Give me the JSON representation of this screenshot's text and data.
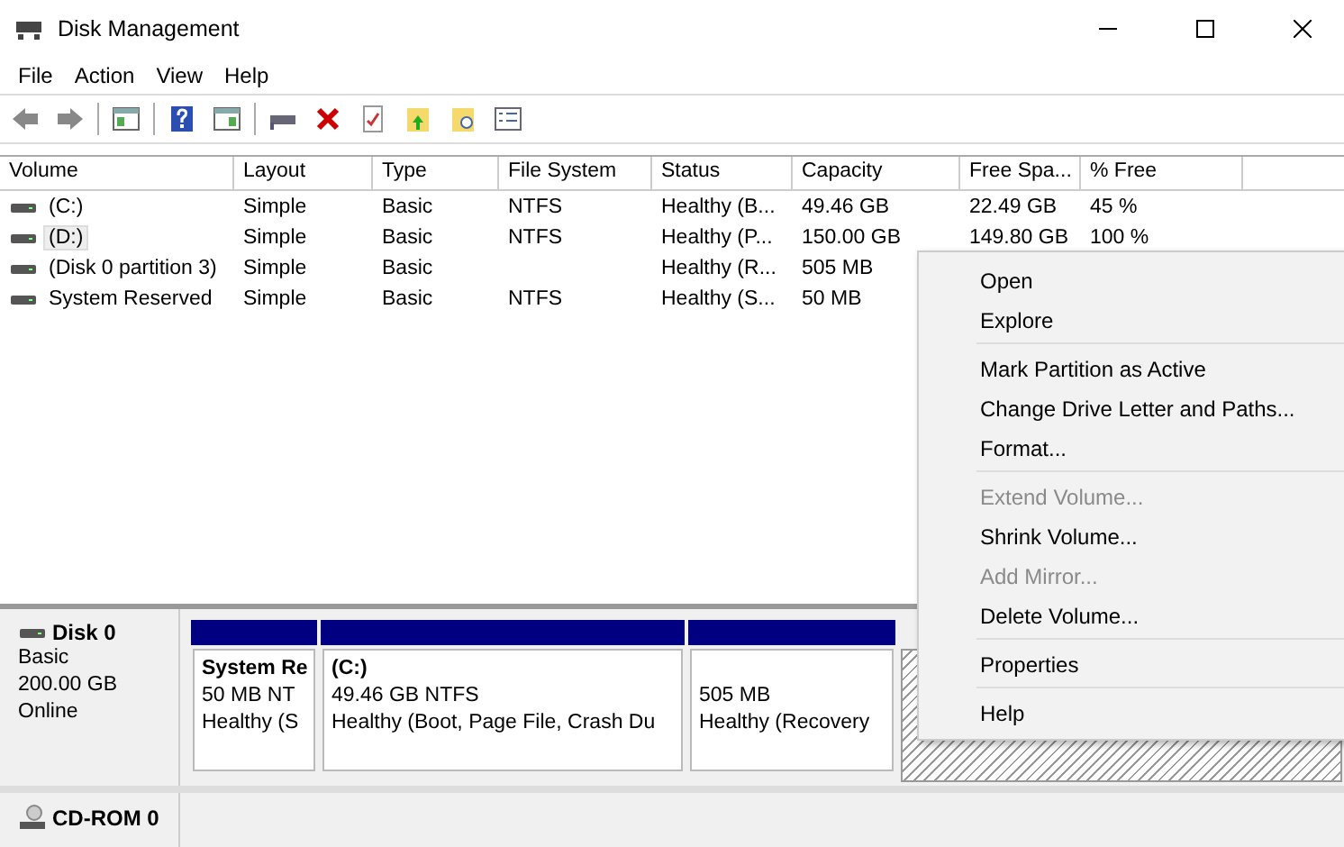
{
  "window": {
    "title": "Disk Management"
  },
  "menu_bar": [
    "File",
    "Action",
    "View",
    "Help"
  ],
  "table": {
    "columns": [
      "Volume",
      "Layout",
      "Type",
      "File System",
      "Status",
      "Capacity",
      "Free Spa...",
      "% Free"
    ],
    "rows": [
      {
        "selected": false,
        "cells": [
          "(C:)",
          "Simple",
          "Basic",
          "NTFS",
          "Healthy (B...",
          "49.46 GB",
          "22.49 GB",
          "45 %"
        ]
      },
      {
        "selected": true,
        "cells": [
          "(D:)",
          "Simple",
          "Basic",
          "NTFS",
          "Healthy (P...",
          "150.00 GB",
          "149.80 GB",
          "100 %"
        ]
      },
      {
        "selected": false,
        "cells": [
          "(Disk 0 partition 3)",
          "Simple",
          "Basic",
          null,
          "Healthy (R...",
          "505 MB",
          null,
          null
        ]
      },
      {
        "selected": false,
        "cells": [
          "System Reserved",
          "Simple",
          "Basic",
          "NTFS",
          "Healthy (S...",
          "50 MB",
          null,
          null
        ]
      }
    ]
  },
  "disks": [
    {
      "name": "Disk 0",
      "kind": "disk",
      "lines": [
        "Basic",
        "200.00 GB",
        "Online"
      ],
      "partitions": [
        {
          "kind": "primary",
          "title": "System Re",
          "lines": [
            "50 MB NT",
            "Healthy (S"
          ]
        },
        {
          "kind": "primary",
          "title": "(C:)",
          "lines": [
            "49.46 GB NTFS",
            "Healthy (Boot, Page File, Crash Du"
          ]
        },
        {
          "kind": "primary",
          "lines": [
            "505 MB",
            "Healthy (Recovery"
          ]
        },
        {
          "kind": "unallocated"
        }
      ]
    },
    {
      "name": "CD-ROM 0",
      "kind": "cdrom"
    }
  ],
  "context_menu": {
    "groups": [
      [
        {
          "label": "Open",
          "disabled": false
        },
        {
          "label": "Explore",
          "disabled": false
        }
      ],
      [
        {
          "label": "Mark Partition as Active",
          "disabled": false
        },
        {
          "label": "Change Drive Letter and Paths...",
          "disabled": false
        },
        {
          "label": "Format...",
          "disabled": false
        }
      ],
      [
        {
          "label": "Extend Volume...",
          "disabled": true
        },
        {
          "label": "Shrink Volume...",
          "disabled": false
        },
        {
          "label": "Add Mirror...",
          "disabled": true
        },
        {
          "label": "Delete Volume...",
          "disabled": false
        }
      ],
      [
        {
          "label": "Properties",
          "disabled": false
        }
      ],
      [
        {
          "label": "Help",
          "disabled": false
        }
      ]
    ]
  }
}
